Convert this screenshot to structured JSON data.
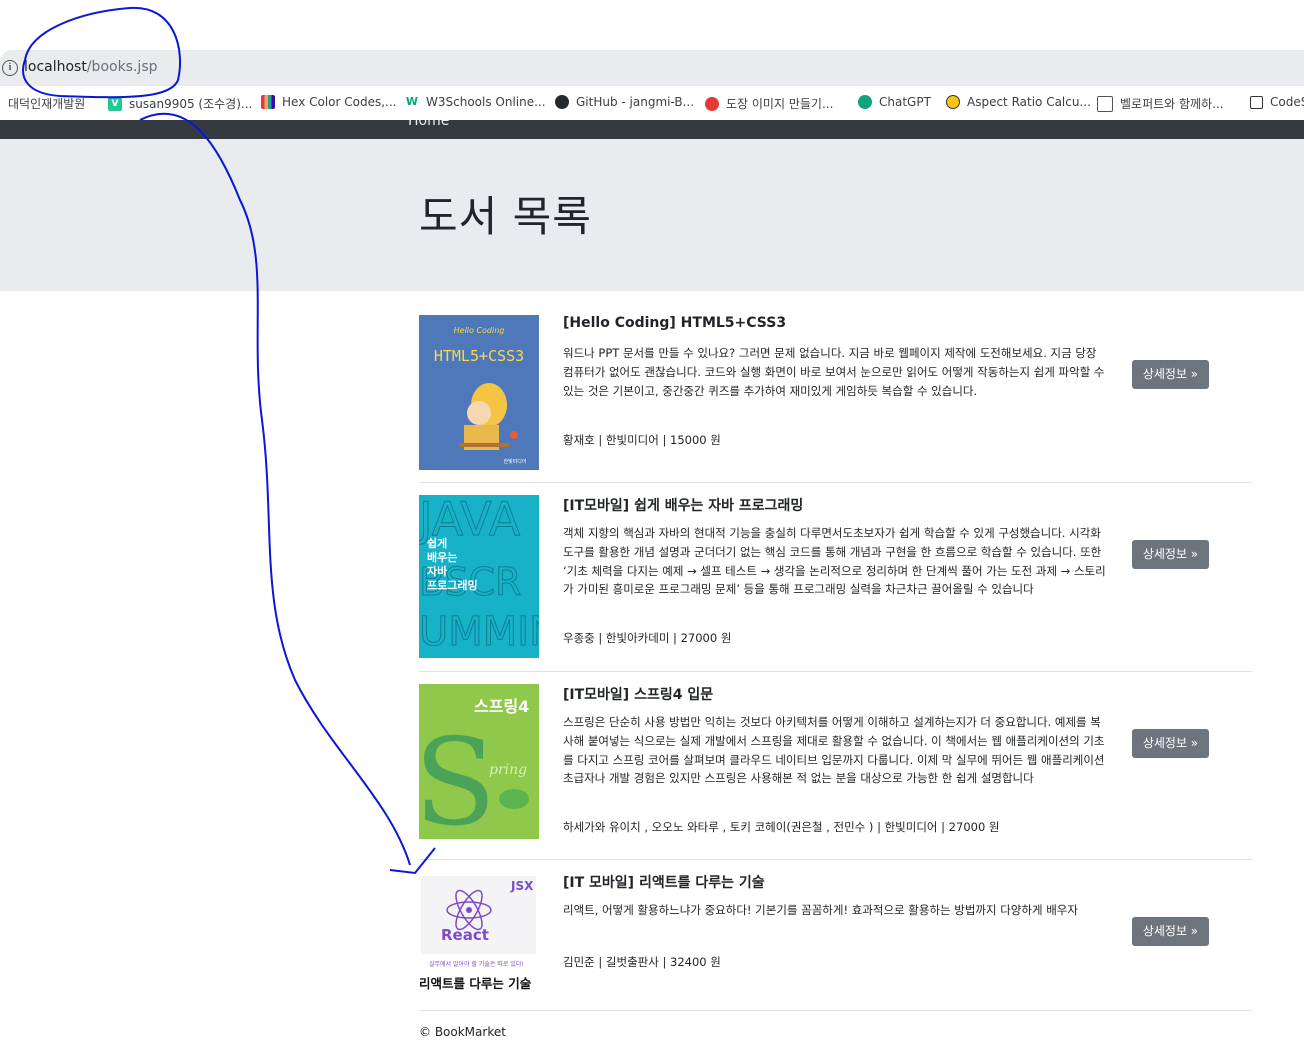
{
  "browser": {
    "url_host": "localhost",
    "url_path": "/books.jsp",
    "bookmarks": [
      {
        "label": "대덕인재개발원"
      },
      {
        "label": "susan9905 (조수경)..."
      },
      {
        "label": "Hex Color Codes,..."
      },
      {
        "label": "W3Schools Online..."
      },
      {
        "label": "GitHub - jangmi-B..."
      },
      {
        "label": "도장 이미지 만들기..."
      },
      {
        "label": "ChatGPT"
      },
      {
        "label": "Aspect Ratio Calcu..."
      },
      {
        "label": "벨로퍼트와 함께하..."
      },
      {
        "label": "CodeS"
      }
    ]
  },
  "nav": {
    "home": "Home"
  },
  "page": {
    "title": "도서 목록"
  },
  "detail_label": "상세정보 »",
  "books": [
    {
      "title": "[Hello Coding] HTML5+CSS3",
      "description": "워드나 PPT 문서를 만들 수 있나요? 그러면 문제 없습니다. 지금 바로 웹페이지 제작에 도전해보세요. 지금 당장 컴퓨터가 없어도 괜찮습니다. 코드와 실행 화면이 바로 보여서 눈으로만 읽어도 어떻게 작동하는지 쉽게 파악할 수 있는 것은 기본이고, 중간중간 퀴즈를 추가하여 재미있게 게임하듯 복습할 수 있습니다.",
      "meta": "황재호 | 한빛미디어 | 15000 원",
      "cover_text": "HTML5+CSS3"
    },
    {
      "title": "[IT모바일] 쉽게 배우는 자바 프로그래밍",
      "description": "객체 지향의 핵심과 자바의 현대적 기능을 충실히 다루면서도초보자가 쉽게 학습할 수 있게 구성했습니다. 시각화 도구를 활용한 개념 설명과 군더더기 없는 핵심 코드를 통해 개념과 구현을 한 흐름으로 학습할 수 있습니다. 또한 ‘기초 체력을 다지는 예제 → 셀프 테스트 → 생각을 논리적으로 정리하며 한 단계씩 풀어 가는 도전 과제 → 스토리가 가미된 흥미로운 프로그래밍 문제’ 등을 통해 프로그래밍 실력을 차근차근 끌어올릴 수 있습니다",
      "meta": "우종중 | 한빛아카데미 | 27000 원",
      "cover_text": "쉽게 배우는 자바 프로그래밍"
    },
    {
      "title": "[IT모바일] 스프링4 입문",
      "description": "스프링은 단순히 사용 방법만 익히는 것보다 아키텍처를 어떻게 이해하고 설계하는지가 더 중요합니다. 예제를 복사해 붙여넣는 식으로는 실제 개발에서 스프링을 제대로 활용할 수 없습니다. 이 책에서는 웹 애플리케이션의 기초를 다지고 스프링 코어를 살펴보며 클라우드 네이티브 입문까지 다룹니다. 이제 막 실무에 뛰어든 웹 애플리케이션 초급자나 개발 경험은 있지만 스프링은 사용해본 적 없는 분을 대상으로 가능한 한 쉽게 설명합니다",
      "meta": "하세가와 유이치 , 오오노 와타루 , 토키 코헤이(권은철 , 전민수 ) | 한빛미디어 | 27000 원",
      "cover_text": "스프링4"
    },
    {
      "title": "[IT 모바일] 리액트를 다루는 기술",
      "description": "리액트, 어떻게 활용하느냐가 중요하다! 기본기를 꼼꼼하게! 효과적으로 활용하는 방법까지 다양하게 배우자",
      "meta": "김민준 | 길벗출판사 | 32400 원",
      "cover_text": "리액트를 다루는 기술"
    }
  ],
  "footer": "© BookMarket",
  "colors": {
    "navbar": "#343a40",
    "jumbotron": "#e9ecef",
    "button": "#6c757d",
    "annotation": "#0000ee"
  }
}
